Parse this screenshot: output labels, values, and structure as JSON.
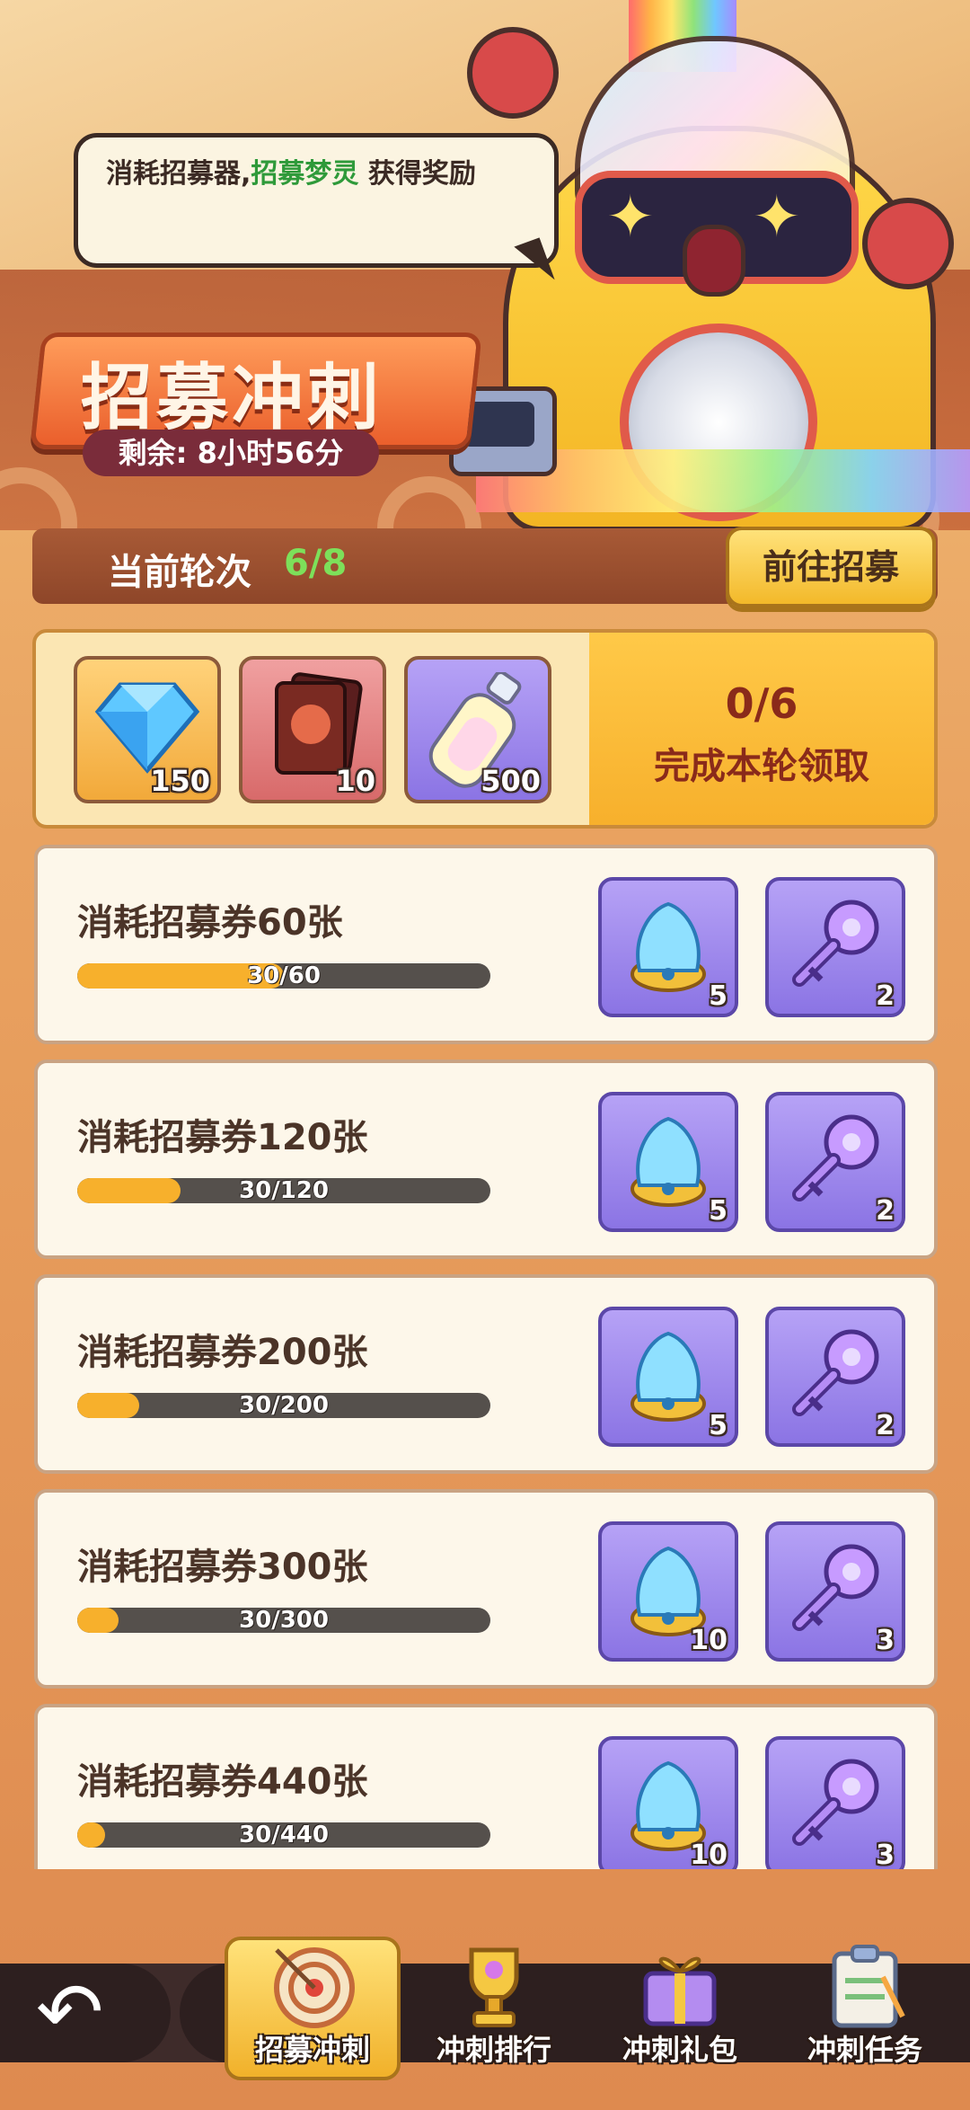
{
  "bubble": {
    "pre": "消耗招募器,",
    "highlight": "招募梦灵",
    "post": " 获得奖励"
  },
  "banner": {
    "title": "招募冲刺",
    "timer": "剩余: 8小时56分"
  },
  "round": {
    "label": "当前轮次",
    "value": "6/8",
    "goto_button": "前往招募"
  },
  "round_rewards": {
    "items": [
      {
        "icon": "diamond-icon",
        "qty": "150"
      },
      {
        "icon": "card-pack-icon",
        "qty": "10"
      },
      {
        "icon": "potion-bottle-icon",
        "qty": "500"
      }
    ],
    "progress": "0/6",
    "claim_text": "完成本轮领取"
  },
  "tasks": [
    {
      "title": "消耗招募券60张",
      "progress_text": "30/60",
      "progress": 0.5,
      "rewards": [
        {
          "icon": "spirit-orb-icon",
          "qty": "5"
        },
        {
          "icon": "purple-key-icon",
          "qty": "2"
        }
      ]
    },
    {
      "title": "消耗招募券120张",
      "progress_text": "30/120",
      "progress": 0.25,
      "rewards": [
        {
          "icon": "spirit-orb-icon",
          "qty": "5"
        },
        {
          "icon": "purple-key-icon",
          "qty": "2"
        }
      ]
    },
    {
      "title": "消耗招募券200张",
      "progress_text": "30/200",
      "progress": 0.15,
      "rewards": [
        {
          "icon": "spirit-orb-icon",
          "qty": "5"
        },
        {
          "icon": "purple-key-icon",
          "qty": "2"
        }
      ]
    },
    {
      "title": "消耗招募券300张",
      "progress_text": "30/300",
      "progress": 0.1,
      "rewards": [
        {
          "icon": "spirit-orb-icon",
          "qty": "10"
        },
        {
          "icon": "purple-key-icon",
          "qty": "3"
        }
      ]
    },
    {
      "title": "消耗招募券440张",
      "progress_text": "30/440",
      "progress": 0.068,
      "rewards": [
        {
          "icon": "spirit-orb-icon",
          "qty": "10"
        },
        {
          "icon": "purple-key-icon",
          "qty": "3"
        }
      ]
    }
  ],
  "nav": {
    "back_icon": "back-arrow-icon",
    "tabs": [
      {
        "label": "招募冲刺",
        "icon": "dartboard-icon",
        "active": true
      },
      {
        "label": "冲刺排行",
        "icon": "trophy-icon",
        "active": false
      },
      {
        "label": "冲刺礼包",
        "icon": "gift-box-icon",
        "active": false
      },
      {
        "label": "冲刺任务",
        "icon": "clipboard-icon",
        "active": false
      }
    ]
  }
}
